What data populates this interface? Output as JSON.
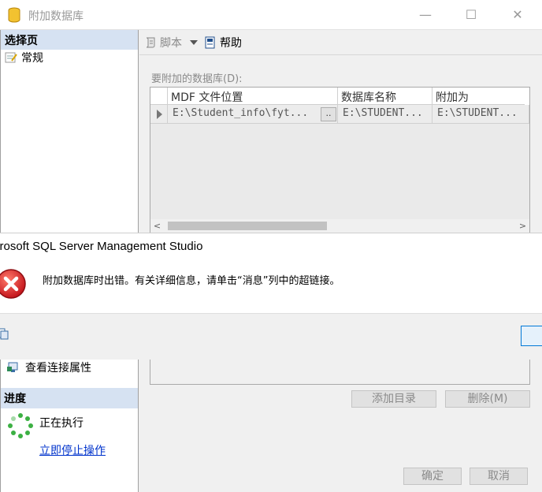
{
  "window": {
    "title": "附加数据库",
    "controls": {
      "minimize": "—",
      "maximize": "☐",
      "close": "✕"
    }
  },
  "sidebar": {
    "select_page_header": "选择页",
    "pages": [
      {
        "label": "常规",
        "icon": "properties-icon"
      }
    ],
    "connection_link": "查看连接属性",
    "progress_header": "进度",
    "progress_status": "正在执行",
    "stop_link": "立即停止操作"
  },
  "toolbar": {
    "script_label": "脚本",
    "help_label": "帮助"
  },
  "main": {
    "section_label": "要附加的数据库(D):",
    "grid": {
      "columns": [
        "MDF 文件位置",
        "数据库名称",
        "附加为"
      ],
      "rows": [
        {
          "mdf": "E:\\Student_info\\fyt...",
          "browse": "..",
          "db_name": "E:\\STUDENT...",
          "attach_as": "E:\\STUDENT..."
        }
      ],
      "scroll_left": "<",
      "scroll_right": ">"
    },
    "add_catalog_button": "添加目录",
    "remove_button": "删除(M)",
    "ok_button": "确定",
    "cancel_button": "取消"
  },
  "error_dialog": {
    "title": "crosoft SQL Server Management Studio",
    "message": "附加数据库时出错。有关详细信息，请单击“消息”列中的超链接。"
  }
}
